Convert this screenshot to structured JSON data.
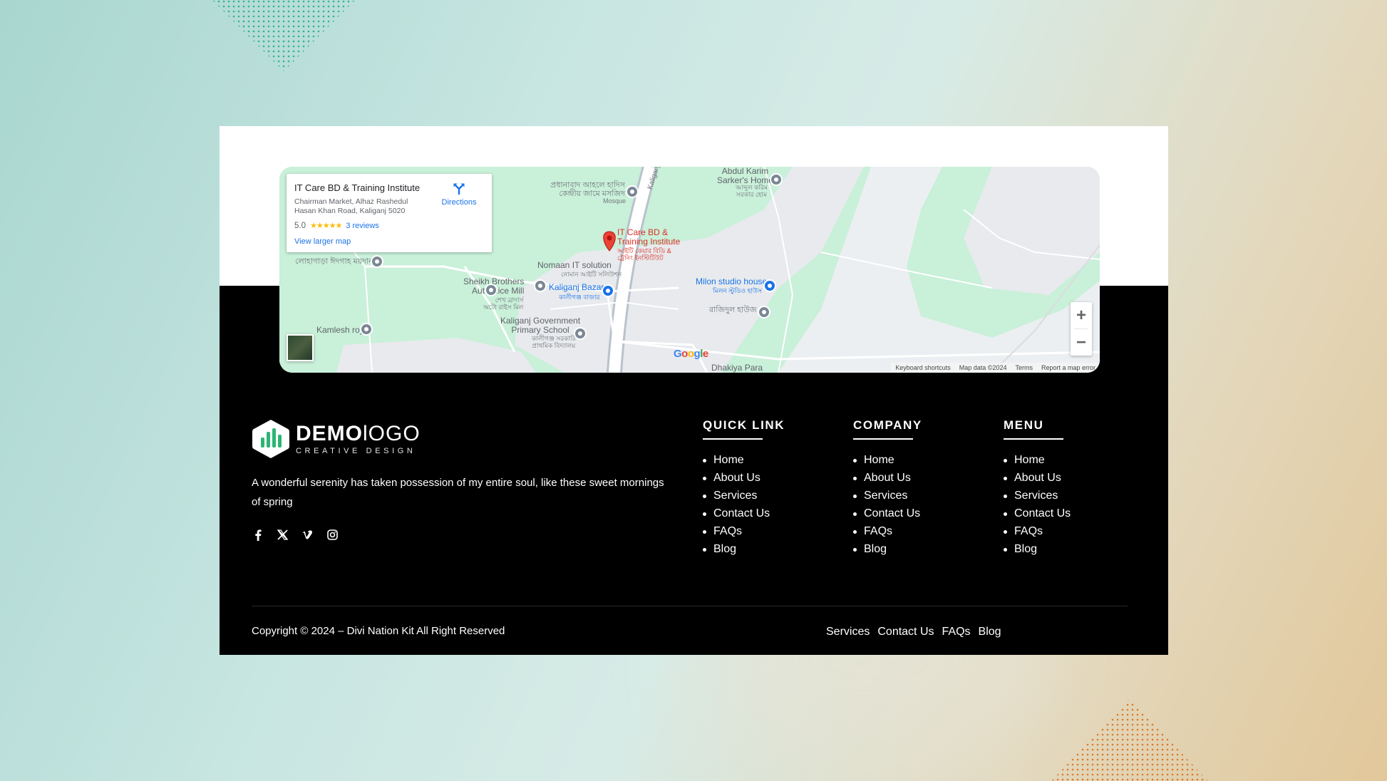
{
  "map": {
    "place_name": "IT Care BD & Training Institute",
    "address": "Chairman Market, Alhaz Rashedul Hasan Khan Road, Kaliganj 5020",
    "rating": "5.0",
    "stars": "★★★★★",
    "reviews": "3 reviews",
    "view_larger": "View larger map",
    "directions": "Directions",
    "zoom_in": "+",
    "zoom_out": "−",
    "google": "Google",
    "footer": {
      "shortcuts": "Keyboard shortcuts",
      "map_data": "Map data ©2024",
      "terms": "Terms",
      "report": "Report a map error"
    },
    "labels": {
      "abdul_karim": "Abdul Karim\nSarker's Home",
      "abdul_karim_bn": "আব্দুল করিম\nসরকার হোম",
      "mosque_bn": "প্রধানাবাদ আহলে হাদিস\nকেন্দ্রীয় জামে মসজিদ",
      "mosque": "Mosque",
      "road": "Kaliganj",
      "marker_en": "IT Care BD &\nTraining Institute",
      "marker_bn": "আইটি কেয়ার বিডি &\nট্রেনিং ইনস্টিটিউট",
      "nomaan": "Nomaan IT solution",
      "nomaan_bn": "নোমান আইটি সলিউশন",
      "eidgah_bn": "লোহাগাড়া ঈদগাহ ময়দান",
      "sheikh_brothers": "Sheikh Brothers\nAuto Rice Mill",
      "sheikh_bn": "শেখ ব্রাদার্স\nঅটো রাইস মিল",
      "kaliganj_bazar": "Kaliganj Bazar",
      "kaliganj_bazar_bn": "কালীগঞ্জ বাজার",
      "milon": "Milon studio house",
      "milon_bn": "মিলন স্টুডিও হাউস",
      "rajidul_bn": "রাজিদুল হাউজ",
      "kamlesh": "Kamlesh roy",
      "school": "Kaliganj Government\nPrimary School",
      "school_bn": "কালীগঞ্জ সরকারি\nপ্রাথমিক বিদ্যালয়",
      "dhakiya": "Dhakiya Para"
    }
  },
  "footer": {
    "logo_main_bold": "DEMO",
    "logo_main_light": "lOGO",
    "logo_sub": "CREATIVE DESIGN",
    "about": "A wonderful serenity has taken possession of my entire soul, like these sweet mornings of spring",
    "socials": [
      "facebook-icon",
      "x-icon",
      "vimeo-icon",
      "instagram-icon"
    ],
    "columns": [
      {
        "title": "QUICK LINK",
        "items": [
          "Home",
          "About Us",
          "Services",
          "Contact Us",
          "FAQs",
          "Blog"
        ]
      },
      {
        "title": "COMPANY",
        "items": [
          "Home",
          "About Us",
          "Services",
          "Contact Us",
          "FAQs",
          "Blog"
        ]
      },
      {
        "title": "MENU",
        "items": [
          "Home",
          "About Us",
          "Services",
          "Contact Us",
          "FAQs",
          "Blog"
        ]
      }
    ],
    "copyright": "Copyright © 2024 – Divi Nation Kit All Right Reserved",
    "bottom_links": [
      "Services",
      "Contact Us",
      "FAQs",
      "Blog"
    ]
  },
  "colors": {
    "accent_green": "#2bb673",
    "map_green": "#c9f0d9",
    "dots_green": "#2fb38a",
    "dots_orange": "#d97a2b"
  }
}
